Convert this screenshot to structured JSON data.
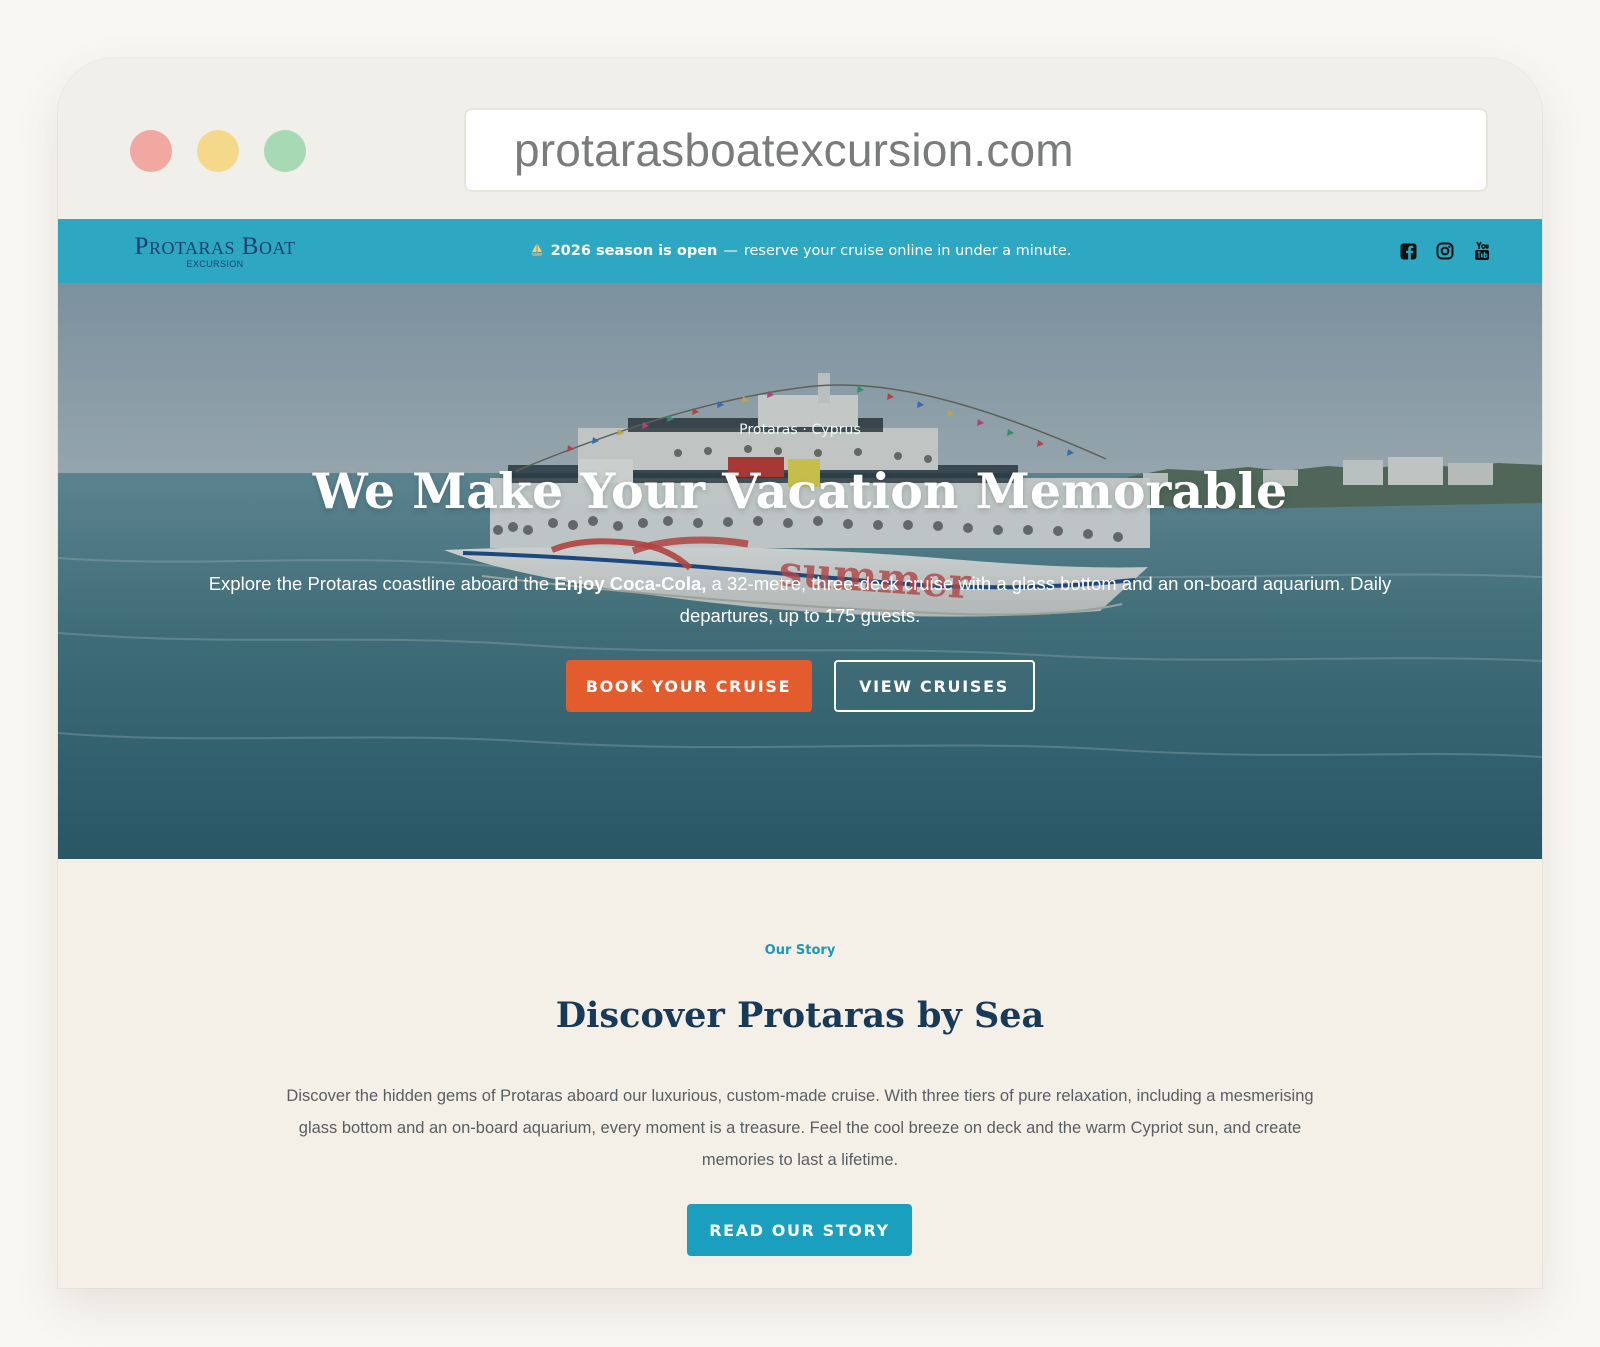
{
  "browser": {
    "url": "protarasboatexcursion.com"
  },
  "topbar": {
    "logo_main": "Protaras Boat",
    "logo_sub": "EXCURSION",
    "announcement_strong": "2026 season is open",
    "announcement_dash": "—",
    "announcement_rest": "reserve your cruise online in under a minute.",
    "icons": [
      "facebook-icon",
      "instagram-icon",
      "youtube-icon"
    ]
  },
  "hero": {
    "eyebrow": "Protaras · Cyprus",
    "title": "We Make Your Vacation Memorable",
    "desc_before": "Explore the Protaras coastline aboard the",
    "desc_strong": "Enjoy Coca-Cola,",
    "desc_after": "a 32-metre, three-deck cruise with a glass bottom and an on-board aquarium. Daily departures, up to 175 guests.",
    "primary_button": "BOOK YOUR CRUISE",
    "secondary_button": "VIEW CRUISES"
  },
  "story": {
    "eyebrow": "Our Story",
    "title": "Discover Protaras by Sea",
    "text": "Discover the hidden gems of Protaras aboard our luxurious, custom-made cruise. With three tiers of pure relaxation, including a mesmerising glass bottom and an on-board aquarium, every moment is a treasure. Feel the cool breeze on deck and the warm Cypriot sun, and create memories to last a lifetime.",
    "button": "READ OUR STORY"
  },
  "colors": {
    "topbar": "#2ea8c2",
    "primary_button": "#e35c2d",
    "story_button": "#1a9fbe",
    "story_title": "#183a59"
  }
}
